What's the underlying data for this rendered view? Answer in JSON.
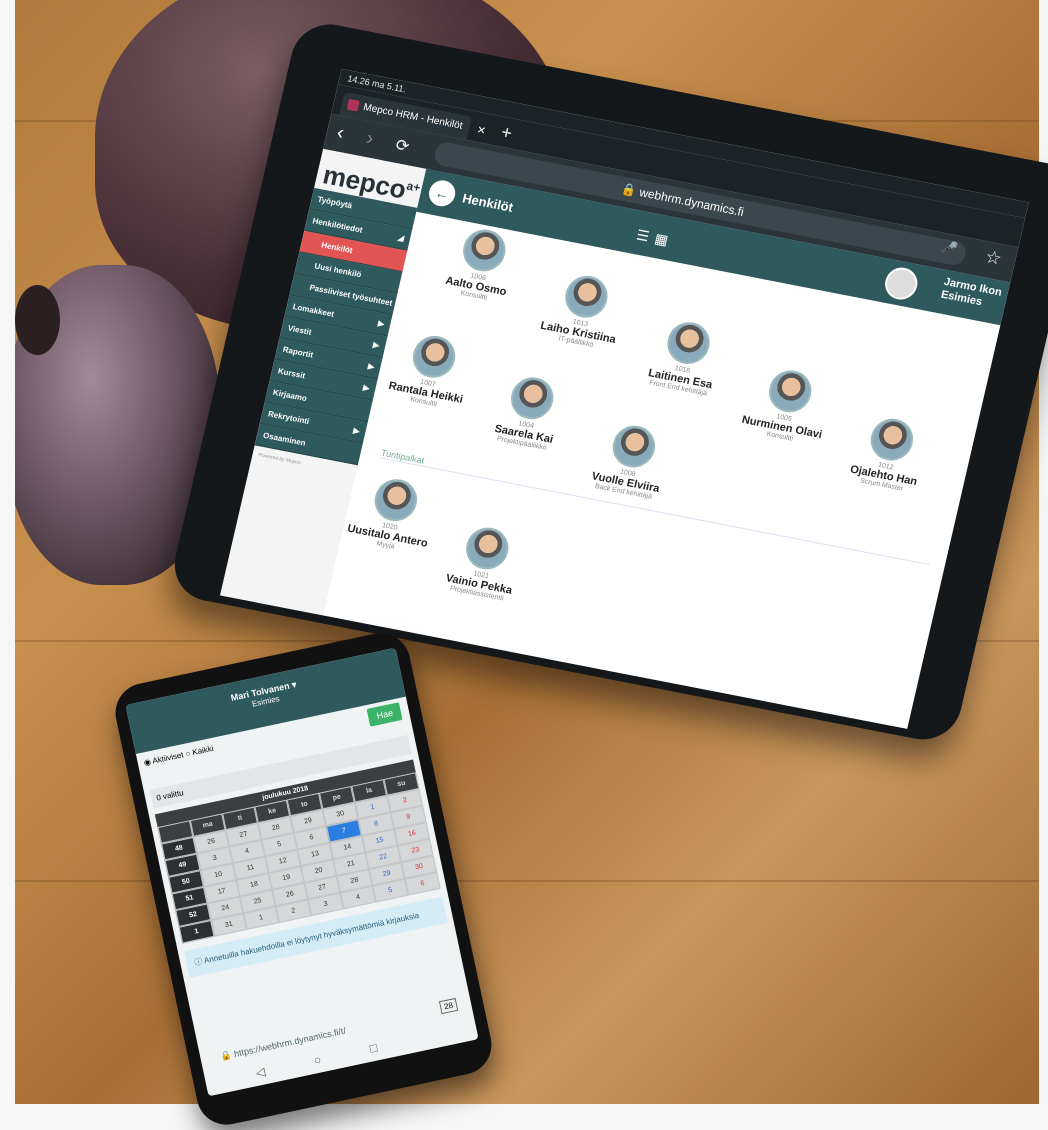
{
  "tablet": {
    "status": "14.26  ma 5.11.",
    "tab_title": "Mepco HRM - Henkilöt",
    "tab_close": "×",
    "tab_new": "+",
    "url": "webhrm.dynamics.fi",
    "logo": "mepco",
    "logo_sup": "a+",
    "sidebar": [
      {
        "label": "Työpöytä"
      },
      {
        "label": "Henkilötiedot",
        "arrow": "◢"
      },
      {
        "label": "Henkilöt",
        "active": true
      },
      {
        "label": "Uusi henkilö",
        "sub": true
      },
      {
        "label": "Passiiviset työsuhteet",
        "sub": true
      },
      {
        "label": "Lomakkeet",
        "arrow": "▶"
      },
      {
        "label": "Viestit",
        "arrow": "▶"
      },
      {
        "label": "Raportit",
        "arrow": "▶"
      },
      {
        "label": "Kurssit",
        "arrow": "▶"
      },
      {
        "label": "Kirjaamo"
      },
      {
        "label": "Rekrytointi",
        "arrow": "▶"
      },
      {
        "label": "Osaaminen"
      }
    ],
    "page_title": "Henkilöt",
    "user_name": "Jarmo Ikon",
    "user_role": "Esimies",
    "people": [
      {
        "id": "1006",
        "name": "Aalto Osmo",
        "role": "Konsultti"
      },
      {
        "id": "1013",
        "name": "Laiho Kristiina",
        "role": "IT-päällikkö"
      },
      {
        "id": "1016",
        "name": "Laitinen Esa",
        "role": "Front End kehittäjä"
      },
      {
        "id": "1005",
        "name": "Nurminen Olavi",
        "role": "Konsultti"
      },
      {
        "id": "1012",
        "name": "Ojalehto Han",
        "role": "Scrum Master"
      },
      {
        "id": "1007",
        "name": "Rantala Heikki",
        "role": "Konsultti"
      },
      {
        "id": "1004",
        "name": "Saarela Kai",
        "role": "Projektipäällikkö"
      },
      {
        "id": "1008",
        "name": "Vuolle Elviira",
        "role": "Back End kehittäjä"
      }
    ],
    "section_label": "Tuntipalkat",
    "hourly": [
      {
        "id": "1020",
        "name": "Uusitalo Antero",
        "role": "Myyjä"
      },
      {
        "id": "1021",
        "name": "Vainio Pekka",
        "role": "Projektiassistentti"
      }
    ]
  },
  "phone": {
    "user_name": "Mari Tolvanen ▾",
    "user_role": "Esimies",
    "radio_active": "Aktiiviset",
    "radio_all": "Kaikki",
    "search_button": "Hae",
    "selected": "0 valittu",
    "calendar_title": "joulukuu 2018",
    "weekdays": [
      "ma",
      "ti",
      "ke",
      "to",
      "pe",
      "la",
      "su"
    ],
    "weeks": [
      {
        "wk": "48",
        "days": [
          "26",
          "27",
          "28",
          "29",
          "30",
          "1",
          "2"
        ]
      },
      {
        "wk": "49",
        "days": [
          "3",
          "4",
          "5",
          "6",
          "7",
          "8",
          "9"
        ]
      },
      {
        "wk": "50",
        "days": [
          "10",
          "11",
          "12",
          "13",
          "14",
          "15",
          "16"
        ]
      },
      {
        "wk": "51",
        "days": [
          "17",
          "18",
          "19",
          "20",
          "21",
          "22",
          "23"
        ]
      },
      {
        "wk": "52",
        "days": [
          "24",
          "25",
          "26",
          "27",
          "28",
          "29",
          "30"
        ]
      },
      {
        "wk": "1",
        "days": [
          "31",
          "1",
          "2",
          "3",
          "4",
          "5",
          "6"
        ]
      }
    ],
    "alert": "Annetuilla hakuehdoilla ei löytynyt hyväksymättömiä kirjauksia",
    "url": "https://webhrm.dynamics.fi/t/",
    "tabs_count": "28"
  }
}
